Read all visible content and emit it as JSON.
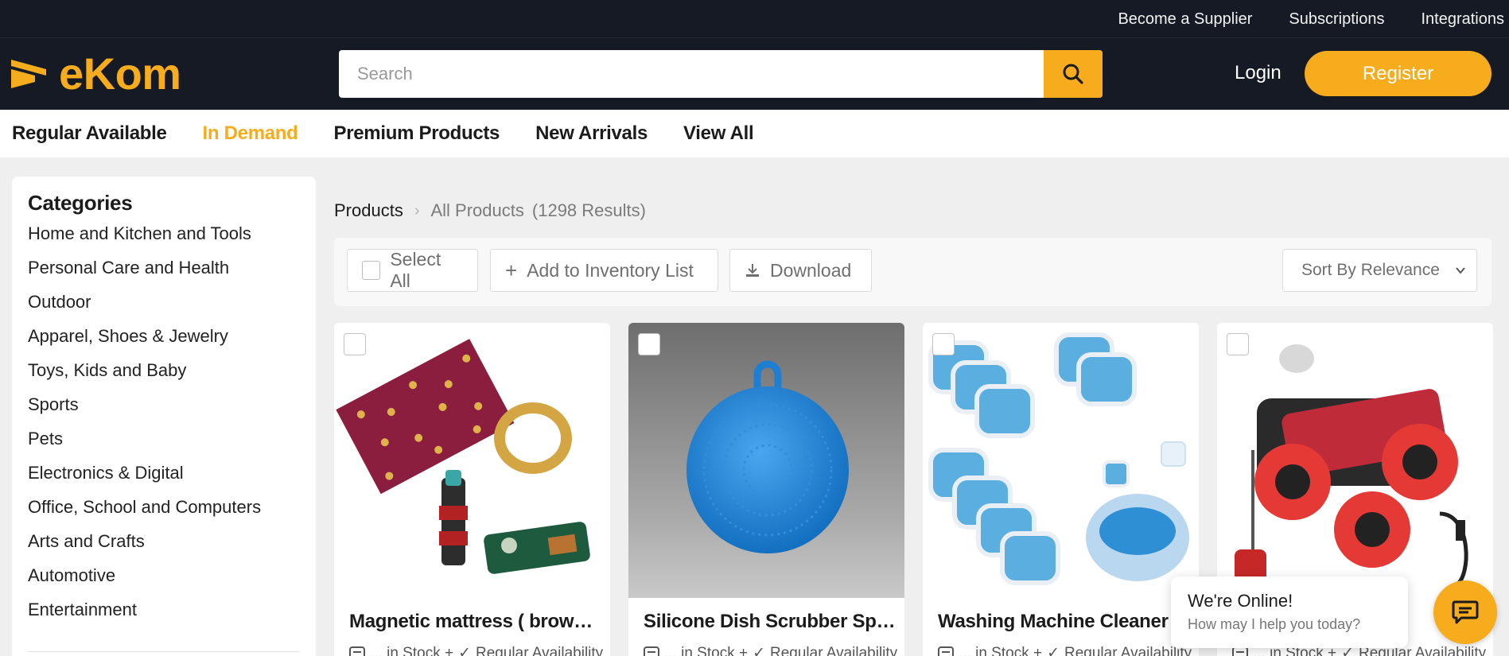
{
  "topbar": {
    "links": [
      "Become a Supplier",
      "Subscriptions",
      "Integrations"
    ]
  },
  "header": {
    "logo_text": "eKom",
    "search_placeholder": "Search",
    "login_label": "Login",
    "register_label": "Register"
  },
  "nav": {
    "items": [
      "Regular Available",
      "In Demand",
      "Premium Products",
      "New Arrivals",
      "View All"
    ],
    "active": "In Demand"
  },
  "sidebar": {
    "title": "Categories",
    "categories": [
      "Home and Kitchen and Tools",
      "Personal Care and Health",
      "Outdoor",
      "Apparel, Shoes & Jewelry",
      "Toys, Kids and Baby",
      "Sports",
      "Pets",
      "Electronics & Digital",
      "Office, School and Computers",
      "Arts and Crafts",
      "Automotive",
      "Entertainment"
    ]
  },
  "breadcrumb": {
    "root": "Products",
    "current": "All Products",
    "count": "(1298 Results)"
  },
  "toolbar": {
    "select_all": "Select All",
    "add_inventory": "Add to Inventory List",
    "download": "Download",
    "sort_value": "Sort By Relevance"
  },
  "products": [
    {
      "title": "Magnetic mattress ( brown,...",
      "stock": "... in Stock +",
      "availability": "Regular Availability"
    },
    {
      "title": "Silicone Dish Scrubber Spo...",
      "stock": "... in Stock +",
      "availability": "Regular Availability"
    },
    {
      "title": "Washing Machine Cleaner ...",
      "stock": "... in Stock +",
      "availability": "Regular Availability"
    },
    {
      "title": "...",
      "stock": "... in Stock +",
      "availability": "Regular Availability"
    }
  ],
  "chat": {
    "title": "We're Online!",
    "subtitle": "How may I help you today?"
  },
  "colors": {
    "brand": "#f6ac1c",
    "header_bg": "#151a24"
  }
}
